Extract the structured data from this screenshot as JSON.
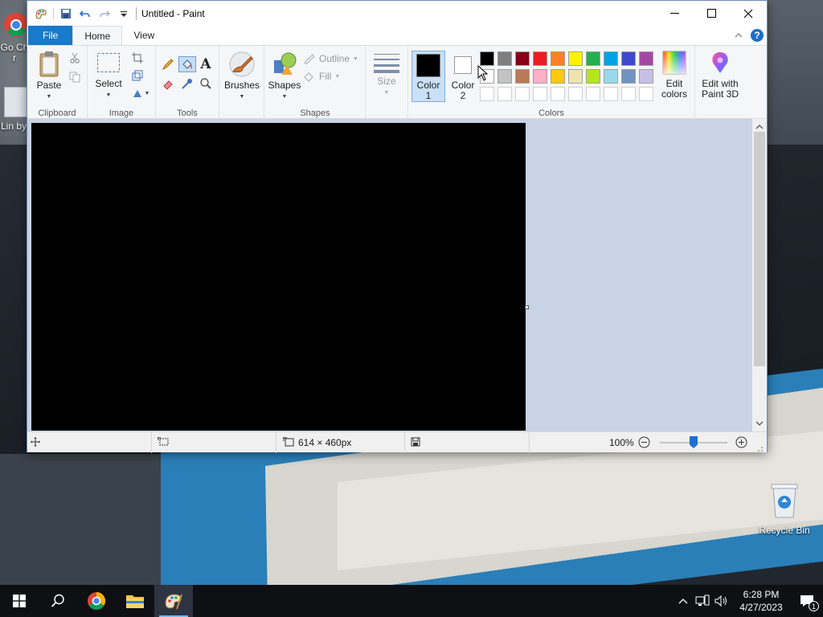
{
  "window": {
    "title": "Untitled - Paint"
  },
  "tabs": {
    "file": "File",
    "home": "Home",
    "view": "View"
  },
  "ribbon": {
    "clipboard": {
      "label": "Clipboard",
      "paste": "Paste"
    },
    "image": {
      "label": "Image",
      "select": "Select"
    },
    "tools": {
      "label": "Tools"
    },
    "brushes": {
      "label": "Brushes"
    },
    "shapes": {
      "label": "Shapes",
      "shapes_btn": "Shapes",
      "outline": "Outline",
      "fill": "Fill"
    },
    "size": {
      "label": "Size"
    },
    "colors": {
      "label": "Colors",
      "color1_line1": "Color",
      "color1_line2": "1",
      "color1_value": "#000000",
      "color2_line1": "Color",
      "color2_line2": "2",
      "color2_value": "#ffffff",
      "edit_colors_line1": "Edit",
      "edit_colors_line2": "colors",
      "palette_row1": [
        "#000000",
        "#7f7f7f",
        "#880015",
        "#ed1c24",
        "#ff7f27",
        "#fff200",
        "#22b14c",
        "#00a2e8",
        "#3f48cc",
        "#a349a4"
      ],
      "palette_row2": [
        "#ffffff",
        "#c3c3c3",
        "#b97a57",
        "#ffaec9",
        "#ffc90e",
        "#efe4b0",
        "#b5e61d",
        "#99d9ea",
        "#7092be",
        "#c8bfe7"
      ]
    },
    "paint3d": {
      "line1": "Edit with",
      "line2": "Paint 3D"
    }
  },
  "status": {
    "dimensions": "614 × 460px",
    "zoom": "100%"
  },
  "desktop": {
    "recycle_bin": "Recycle Bin",
    "icon_partial_1": "Go Chr",
    "icon_partial_2": "Lin by"
  },
  "taskbar": {
    "time": "6:28 PM",
    "date": "4/27/2023",
    "notif_count": "1"
  }
}
